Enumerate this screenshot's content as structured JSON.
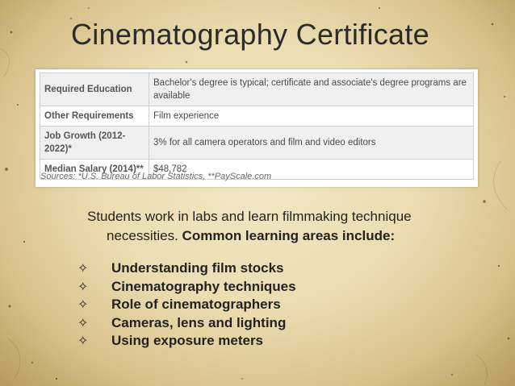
{
  "slide": {
    "title": "Cinematography Certificate"
  },
  "info_table": {
    "rows": [
      {
        "label": "Required Education",
        "value": "Bachelor's degree is typical; certificate and associate's degree programs are available"
      },
      {
        "label": "Other Requirements",
        "value": "Film experience"
      },
      {
        "label": "Job Growth (2012-2022)*",
        "value": "3% for all camera operators and film and video editors"
      },
      {
        "label": "Median Salary (2014)**",
        "value": "$48,782"
      }
    ],
    "sources": "Sources: *U.S. Bureau of Labor Statistics, **PayScale.com"
  },
  "body": {
    "intro_line1": "Students work in labs and learn filmmaking technique",
    "intro_line2_plain": "necessities. ",
    "intro_line2_bold": "Common learning areas include:",
    "bullet_glyph": "✧",
    "bullets": [
      "Understanding film stocks",
      "Cinematography techniques",
      "Role of cinematographers",
      "Cameras, lens and lighting",
      "Using exposure meters"
    ]
  },
  "colors": {
    "background": "#ebdcb0",
    "text": "#222222",
    "table_stripe": "#f0f0f0"
  }
}
